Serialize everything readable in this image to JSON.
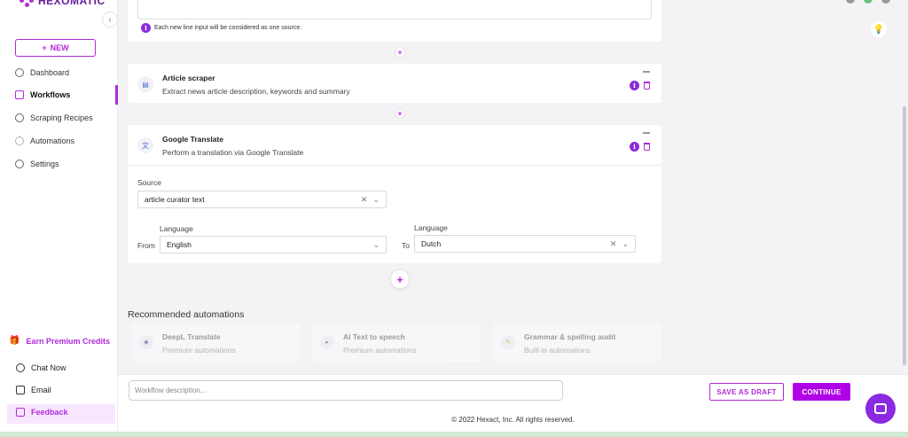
{
  "brand": {
    "name": "HEXOMATIC"
  },
  "sidebar": {
    "new_label": "NEW",
    "items": [
      {
        "label": "Dashboard",
        "icon": "clock-icon"
      },
      {
        "label": "Workflows",
        "icon": "workflow-icon",
        "active": true
      },
      {
        "label": "Scraping Recipes",
        "icon": "recipe-icon"
      },
      {
        "label": "Automations",
        "icon": "bulb-icon"
      },
      {
        "label": "Settings",
        "icon": "gear-icon"
      }
    ],
    "earn_label": "Earn Premium Credits",
    "chat_label": "Chat Now",
    "email_label": "Email",
    "feedback_label": "Feedback"
  },
  "input_step": {
    "hint": "Each new line input will be considered as one source."
  },
  "steps": [
    {
      "title": "Article scraper",
      "description": "Extract news article description, keywords and summary"
    },
    {
      "title": "Google Translate",
      "description": "Perform a translation via Google Translate"
    }
  ],
  "translate_form": {
    "source_label": "Source",
    "source_value": "article curator text",
    "language_label_from": "Language",
    "language_label_to": "Language",
    "from_label": "From",
    "to_label": "To",
    "from_value": "English",
    "to_value": "Dutch"
  },
  "recommended": {
    "title": "Recommended automations",
    "items": [
      {
        "name": "DeepL Translate",
        "type": "Premium automations"
      },
      {
        "name": "AI Text to speech",
        "type": "Premium automations"
      },
      {
        "name": "Grammar & spelling audit",
        "type": "Built-in automations"
      }
    ]
  },
  "bottombar": {
    "description_placeholder": "Workflow description...",
    "save_draft_label": "SAVE AS DRAFT",
    "continue_label": "CONTINUE"
  },
  "footer": {
    "copyright": "© 2022 Hexact, Inc. All rights reserved."
  },
  "colors": {
    "accent": "#b02bd8",
    "primary_button": "#b000e6"
  }
}
